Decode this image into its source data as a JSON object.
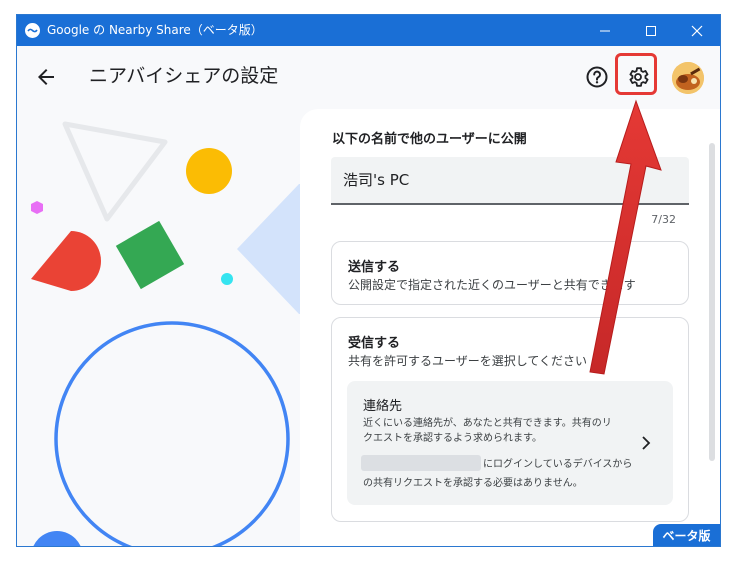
{
  "window": {
    "title": "Google の Nearby Share（ベータ版）",
    "controls": {
      "minimize": "minimize",
      "maximize": "maximize",
      "close": "close"
    }
  },
  "header": {
    "title": "ニアバイシェアの設定",
    "icons": [
      "arrow-back-icon",
      "help-icon",
      "gear-icon",
      "avatar"
    ]
  },
  "device_name": {
    "label": "以下の名前で他のユーザーに公開",
    "value": "浩司's PC",
    "counter": "7/32"
  },
  "send": {
    "title": "送信する",
    "description": "公開設定で指定された近くのユーザーと共有できます"
  },
  "receive": {
    "title": "受信する",
    "description": "共有を許可するユーザーを選択してください",
    "contacts": {
      "title": "連絡先",
      "line1": "近くにいる連絡先が、あなたと共有できます。共有のリ",
      "line2": "クエストを承認するよう求められます。",
      "line3": "にログインしているデバイスから",
      "line4": "の共有リクエストを承認する必要はありません。"
    }
  },
  "badge": {
    "beta": "ベータ版"
  },
  "colors": {
    "titlebar": "#1a6fd6",
    "highlight": "#e53935",
    "accent_blue": "#4285f4",
    "accent_yellow": "#fbbc04",
    "accent_green": "#34a853",
    "accent_red": "#ea4335"
  }
}
